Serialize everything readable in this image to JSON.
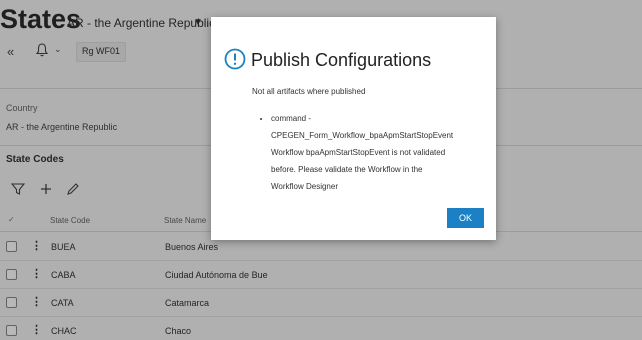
{
  "header": {
    "title": "States",
    "subtitle": "AR - the Argentine Republic",
    "subtitle_caret": "▼"
  },
  "toolbar": {
    "back_icon": "«",
    "bell_icon": "bell-icon",
    "caret": "⌄",
    "chip_label": "Rg WF01"
  },
  "country": {
    "label": "Country",
    "value": "AR - the Argentine Republic"
  },
  "section": {
    "title": "State Codes",
    "tools": [
      "filter-icon",
      "plus-icon",
      "pencil-icon"
    ]
  },
  "table": {
    "check_header": "✓",
    "columns": [
      "State Code",
      "State Name"
    ],
    "rows": [
      {
        "code": "BUEA",
        "name": "Buenos Aires"
      },
      {
        "code": "CABA",
        "name": "Ciudad Autónoma de Bue"
      },
      {
        "code": "CATA",
        "name": "Catamarca"
      },
      {
        "code": "CHAC",
        "name": "Chaco"
      }
    ],
    "kebab": "⋮"
  },
  "dialog": {
    "icon": "info-circle-icon",
    "title": "Publish Configurations",
    "message": "Not all artifacts where published",
    "items": [
      "command -",
      "CPEGEN_Form_Workflow_bpaApmStartStopEvent",
      "Workflow bpaApmStartStopEvent is not validated",
      "before. Please validate the Workflow in the",
      "Workflow Designer"
    ],
    "ok_label": "OK"
  },
  "colors": {
    "accent": "#1b81c4",
    "background": "#f4f4f4"
  }
}
